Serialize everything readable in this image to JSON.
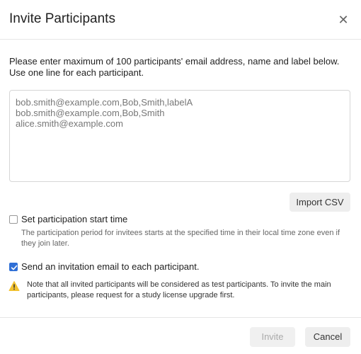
{
  "dialog": {
    "title": "Invite Participants",
    "close_icon": "close-icon"
  },
  "instructions": "Please enter maximum of 100 participants' email address, name and label below. Use one line for each participant.",
  "participants_textarea": {
    "value": "bob.smith@example.com,Bob,Smith,labelA\nbob.smith@example.com,Bob,Smith\nalice.smith@example.com"
  },
  "import_csv_label": "Import CSV",
  "start_time": {
    "label": "Set participation start time",
    "checked": false,
    "help": "The participation period for invitees starts at the specified time in their local time zone even if they join later."
  },
  "send_email": {
    "label": "Send an invitation email to each participant.",
    "checked": true
  },
  "warning": {
    "icon": "warning-icon",
    "text": "Note that all invited participants will be considered as test participants. To invite the main participants, please request for a study license upgrade first."
  },
  "footer": {
    "invite_label": "Invite",
    "cancel_label": "Cancel"
  },
  "colors": {
    "accent": "#2f6fd6",
    "warning": "#f2c230"
  }
}
